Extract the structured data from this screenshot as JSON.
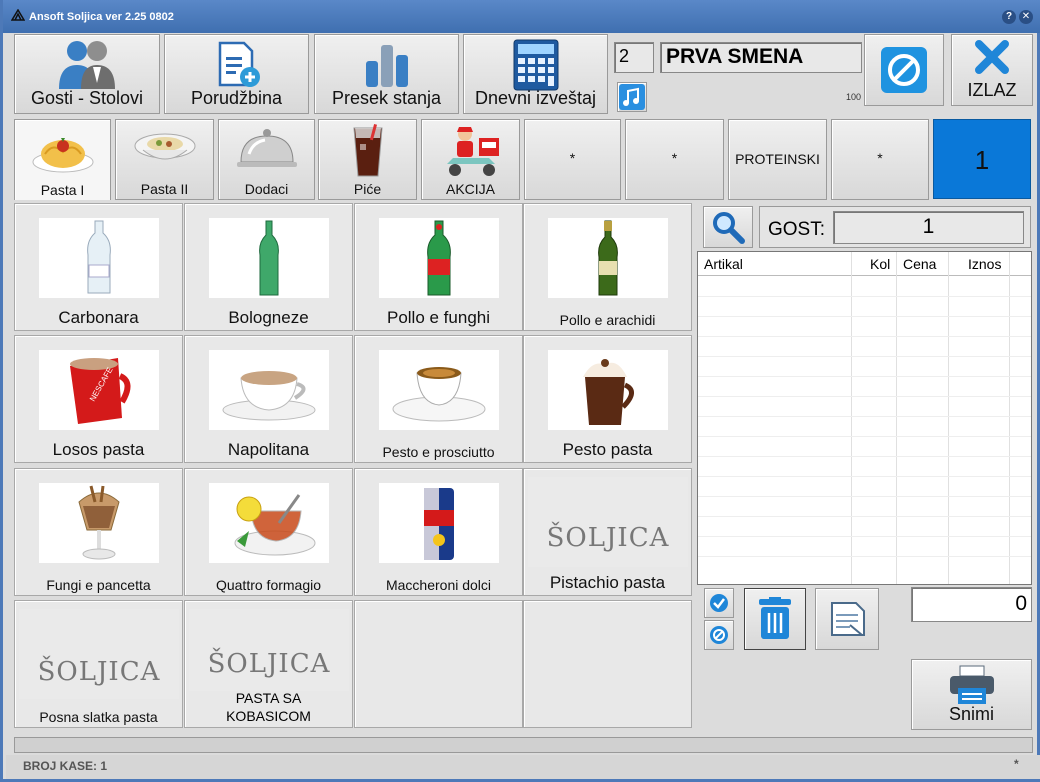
{
  "window": {
    "title": "Ansoft Soljica ver 2.25 0802"
  },
  "toolbar": {
    "gosti_stolovi": "Gosti - Stolovi",
    "porudzbina": "Porudžbina",
    "presek_stanja": "Presek stanja",
    "dnevni_izvestaj": "Dnevni izveštaj",
    "izlaz": "IZLAZ"
  },
  "shift": {
    "number": "2",
    "name": "PRVA SMENA",
    "small_value": "100"
  },
  "categories": [
    {
      "label": "Pasta I",
      "icon": "spaghetti-icon"
    },
    {
      "label": "Pasta II",
      "icon": "bowl-icon"
    },
    {
      "label": "Dodaci",
      "icon": "cloche-icon"
    },
    {
      "label": "Piće",
      "icon": "drink-icon"
    },
    {
      "label": "AKCIJA",
      "icon": "delivery-icon"
    },
    {
      "label": "*"
    },
    {
      "label": "*"
    },
    {
      "label": "PROTEINSKI"
    },
    {
      "label": "*"
    }
  ],
  "page_number": "1",
  "products": [
    {
      "label": "Carbonara",
      "icon": "water-bottle-icon"
    },
    {
      "label": "Bologneze",
      "icon": "green-bottle-icon"
    },
    {
      "label": "Pollo e funghi",
      "icon": "mineral-water-icon"
    },
    {
      "label": "Pollo e arachidi",
      "icon": "beer-bottle-icon"
    },
    {
      "label": "Losos pasta",
      "icon": "red-mug-icon"
    },
    {
      "label": "Napolitana",
      "icon": "coffee-cup-icon"
    },
    {
      "label": "Pesto e prosciutto",
      "icon": "espresso-icon"
    },
    {
      "label": "Pesto pasta",
      "icon": "hot-chocolate-icon"
    },
    {
      "label": "Fungi e pancetta",
      "icon": "ice-cream-icon"
    },
    {
      "label": "Quattro formagio",
      "icon": "tea-cup-icon"
    },
    {
      "label": "Maccheroni dolci",
      "icon": "energy-can-icon"
    },
    {
      "label": "Pistachio pasta",
      "icon": "soljica-logo",
      "logo_text": "ŠOLJICA"
    },
    {
      "label": "Posna slatka pasta",
      "icon": "soljica-logo",
      "logo_text": "ŠOLJICA"
    },
    {
      "label_line1": "PASTA SA",
      "label_line2": "KOBASICOM",
      "icon": "soljica-logo",
      "logo_text": "ŠOLJICA"
    }
  ],
  "guest": {
    "label": "GOST:",
    "value": "1"
  },
  "order_table": {
    "columns": [
      "Artikal",
      "Kol",
      "Cena",
      "Iznos"
    ],
    "rows": []
  },
  "total": "0",
  "actions": {
    "snimi": "Snimi"
  },
  "footer": {
    "broj_kase": "BROJ KASE: 1",
    "indicator": "*"
  },
  "colors": {
    "accent_blue": "#0a78d8",
    "titlebar": "#4a7cc0"
  }
}
